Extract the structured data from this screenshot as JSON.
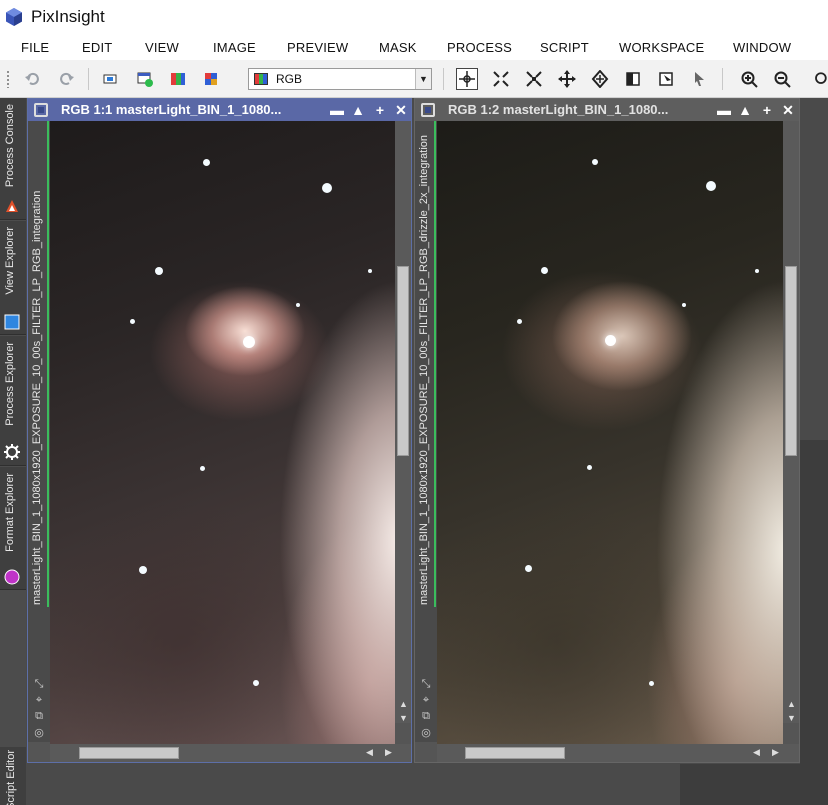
{
  "app": {
    "title": "PixInsight"
  },
  "menu": [
    "FILE",
    "EDIT",
    "VIEW",
    "IMAGE",
    "PREVIEW",
    "MASK",
    "PROCESS",
    "SCRIPT",
    "WORKSPACE",
    "WINDOW"
  ],
  "toolbar": {
    "channel_select": {
      "value": "RGB"
    },
    "icons": [
      "undo-icon",
      "redo-icon",
      "new-instance-icon",
      "new-image-icon",
      "rgb-channels-icon",
      "color-image-icon",
      "pan-mode-icon",
      "zoom-fit-icon",
      "shrink-icon",
      "move-icon",
      "expand-icon",
      "readout-icon",
      "preview-icon",
      "pointer-icon",
      "zoom-in-icon",
      "zoom-out-icon"
    ]
  },
  "side_tabs": {
    "process_console": "Process Console",
    "view_explorer": "View Explorer",
    "process_explorer": "Process Explorer",
    "format_explorer": "Format Explorer",
    "script_editor": "Script Editor"
  },
  "windows": [
    {
      "title": "RGB 1:1 masterLight_BIN_1_1080...",
      "view_id": "masterLight_BIN_1_1080x1920_EXPOSURE_10_00s_FILTER_LP_RGB_integration",
      "state": "active"
    },
    {
      "title": "RGB 1:2 masterLight_BIN_1_1080...",
      "view_id": "masterLight_BIN_1_1080x1920_EXPOSURE_10_00s_FILTER_LP_RGB_drizzle_2x_integration",
      "state": "inactive"
    }
  ],
  "colors": {
    "active_title": "#5a68a6",
    "inactive_title": "#5e5e5e",
    "view_marker": "#3bbd5c",
    "workspace": "#4a4a4a"
  }
}
